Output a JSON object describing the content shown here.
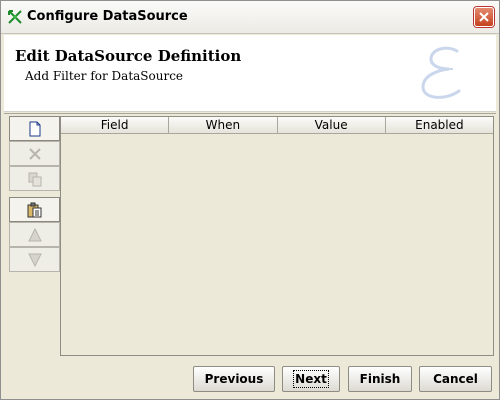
{
  "window": {
    "title": "Configure DataSource",
    "close_icon": "close-icon",
    "app_icon": "datasource-app-icon"
  },
  "header": {
    "title": "Edit DataSource Definition",
    "subtitle": "Add Filter for DataSource",
    "watermark_icon": "script-e-watermark-icon"
  },
  "toolbar": {
    "buttons": [
      {
        "icon": "new-document-icon",
        "enabled": true
      },
      {
        "icon": "delete-x-icon",
        "enabled": false
      },
      {
        "icon": "copy-icon",
        "enabled": false
      },
      {
        "icon": "paste-icon",
        "enabled": true
      },
      {
        "icon": "move-up-icon",
        "enabled": false
      },
      {
        "icon": "move-down-icon",
        "enabled": false
      }
    ]
  },
  "table": {
    "columns": [
      "Field",
      "When",
      "Value",
      "Enabled"
    ],
    "rows": []
  },
  "footer": {
    "previous": "Previous",
    "next": "Next",
    "finish": "Finish",
    "cancel": "Cancel"
  },
  "colors": {
    "panel": "#ece9d8",
    "close_button": "#c4421f"
  }
}
